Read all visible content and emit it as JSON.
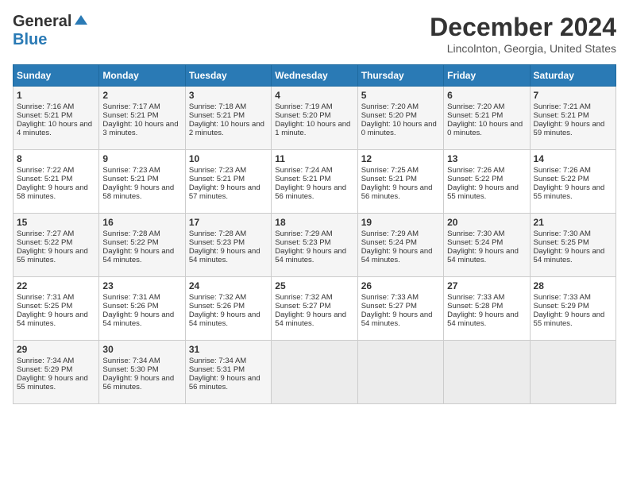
{
  "header": {
    "logo_line1": "General",
    "logo_line2": "Blue",
    "month_title": "December 2024",
    "location": "Lincolnton, Georgia, United States"
  },
  "days_of_week": [
    "Sunday",
    "Monday",
    "Tuesday",
    "Wednesday",
    "Thursday",
    "Friday",
    "Saturday"
  ],
  "weeks": [
    [
      {
        "day": "1",
        "sunrise": "7:16 AM",
        "sunset": "5:21 PM",
        "daylight": "10 hours and 4 minutes."
      },
      {
        "day": "2",
        "sunrise": "7:17 AM",
        "sunset": "5:21 PM",
        "daylight": "10 hours and 3 minutes."
      },
      {
        "day": "3",
        "sunrise": "7:18 AM",
        "sunset": "5:21 PM",
        "daylight": "10 hours and 2 minutes."
      },
      {
        "day": "4",
        "sunrise": "7:19 AM",
        "sunset": "5:20 PM",
        "daylight": "10 hours and 1 minute."
      },
      {
        "day": "5",
        "sunrise": "7:20 AM",
        "sunset": "5:20 PM",
        "daylight": "10 hours and 0 minutes."
      },
      {
        "day": "6",
        "sunrise": "7:20 AM",
        "sunset": "5:21 PM",
        "daylight": "10 hours and 0 minutes."
      },
      {
        "day": "7",
        "sunrise": "7:21 AM",
        "sunset": "5:21 PM",
        "daylight": "9 hours and 59 minutes."
      }
    ],
    [
      {
        "day": "8",
        "sunrise": "7:22 AM",
        "sunset": "5:21 PM",
        "daylight": "9 hours and 58 minutes."
      },
      {
        "day": "9",
        "sunrise": "7:23 AM",
        "sunset": "5:21 PM",
        "daylight": "9 hours and 58 minutes."
      },
      {
        "day": "10",
        "sunrise": "7:23 AM",
        "sunset": "5:21 PM",
        "daylight": "9 hours and 57 minutes."
      },
      {
        "day": "11",
        "sunrise": "7:24 AM",
        "sunset": "5:21 PM",
        "daylight": "9 hours and 56 minutes."
      },
      {
        "day": "12",
        "sunrise": "7:25 AM",
        "sunset": "5:21 PM",
        "daylight": "9 hours and 56 minutes."
      },
      {
        "day": "13",
        "sunrise": "7:26 AM",
        "sunset": "5:22 PM",
        "daylight": "9 hours and 55 minutes."
      },
      {
        "day": "14",
        "sunrise": "7:26 AM",
        "sunset": "5:22 PM",
        "daylight": "9 hours and 55 minutes."
      }
    ],
    [
      {
        "day": "15",
        "sunrise": "7:27 AM",
        "sunset": "5:22 PM",
        "daylight": "9 hours and 55 minutes."
      },
      {
        "day": "16",
        "sunrise": "7:28 AM",
        "sunset": "5:22 PM",
        "daylight": "9 hours and 54 minutes."
      },
      {
        "day": "17",
        "sunrise": "7:28 AM",
        "sunset": "5:23 PM",
        "daylight": "9 hours and 54 minutes."
      },
      {
        "day": "18",
        "sunrise": "7:29 AM",
        "sunset": "5:23 PM",
        "daylight": "9 hours and 54 minutes."
      },
      {
        "day": "19",
        "sunrise": "7:29 AM",
        "sunset": "5:24 PM",
        "daylight": "9 hours and 54 minutes."
      },
      {
        "day": "20",
        "sunrise": "7:30 AM",
        "sunset": "5:24 PM",
        "daylight": "9 hours and 54 minutes."
      },
      {
        "day": "21",
        "sunrise": "7:30 AM",
        "sunset": "5:25 PM",
        "daylight": "9 hours and 54 minutes."
      }
    ],
    [
      {
        "day": "22",
        "sunrise": "7:31 AM",
        "sunset": "5:25 PM",
        "daylight": "9 hours and 54 minutes."
      },
      {
        "day": "23",
        "sunrise": "7:31 AM",
        "sunset": "5:26 PM",
        "daylight": "9 hours and 54 minutes."
      },
      {
        "day": "24",
        "sunrise": "7:32 AM",
        "sunset": "5:26 PM",
        "daylight": "9 hours and 54 minutes."
      },
      {
        "day": "25",
        "sunrise": "7:32 AM",
        "sunset": "5:27 PM",
        "daylight": "9 hours and 54 minutes."
      },
      {
        "day": "26",
        "sunrise": "7:33 AM",
        "sunset": "5:27 PM",
        "daylight": "9 hours and 54 minutes."
      },
      {
        "day": "27",
        "sunrise": "7:33 AM",
        "sunset": "5:28 PM",
        "daylight": "9 hours and 54 minutes."
      },
      {
        "day": "28",
        "sunrise": "7:33 AM",
        "sunset": "5:29 PM",
        "daylight": "9 hours and 55 minutes."
      }
    ],
    [
      {
        "day": "29",
        "sunrise": "7:34 AM",
        "sunset": "5:29 PM",
        "daylight": "9 hours and 55 minutes."
      },
      {
        "day": "30",
        "sunrise": "7:34 AM",
        "sunset": "5:30 PM",
        "daylight": "9 hours and 56 minutes."
      },
      {
        "day": "31",
        "sunrise": "7:34 AM",
        "sunset": "5:31 PM",
        "daylight": "9 hours and 56 minutes."
      },
      null,
      null,
      null,
      null
    ]
  ]
}
